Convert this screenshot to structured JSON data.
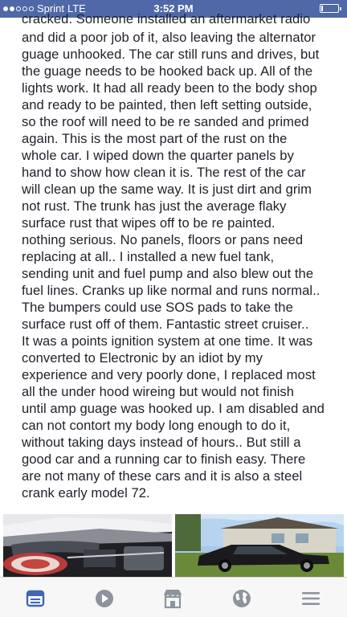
{
  "status_bar": {
    "carrier": "Sprint",
    "network": "LTE",
    "time": "3:52 PM",
    "signal_bars_filled": 2,
    "signal_bars_total": 5,
    "battery_level": 0.12
  },
  "post": {
    "lines": [
      "cracked. Someone installed an aftermarket radio",
      "and did a poor job of it, also leaving the alternator",
      "guage unhooked. The car still runs and drives, but",
      "the guage needs to be hooked back up. All of the",
      "lights work. It had all ready been to the body shop",
      "and ready to be painted, then left setting outside,",
      "so the roof will need to be re sanded and primed",
      "again. This is the most part of the rust on the",
      "whole car. I wiped down the quarter panels by",
      "hand to show how clean it is. The rest of the car",
      "will clean up the same way. It is just dirt and grim",
      "not rust. The trunk has just the average flaky",
      "surface rust that wipes off to be re painted.",
      "nothing serious. No panels, floors or pans need",
      "replacing at all.. I installed a new fuel tank,",
      "sending unit and fuel pump and also blew out the",
      "fuel lines. Cranks up like normal and runs normal..",
      "The bumpers could use SOS pads to take the",
      "surface rust off of them. Fantastic street cruiser..",
      "It was a points ignition system at one time. It was",
      "converted to Electronic by an idiot by my",
      "experience and very poorly done,  I replaced most",
      "all the under hood wireing but would not finish",
      "until amp guage was hooked up. I am disabled and",
      "can not contort my body long enough to do it,",
      "without taking days  instead of hours.. But still a",
      "good car and a running car to finish easy. There",
      "are not many of these cars and it is also a steel",
      "crank early model 72."
    ]
  },
  "tab_bar": {
    "tabs": [
      "news-feed-icon",
      "video-icon",
      "marketplace-icon",
      "globe-icon",
      "menu-icon"
    ],
    "active_color": "#4267b2",
    "inactive_color": "#8d949e"
  }
}
